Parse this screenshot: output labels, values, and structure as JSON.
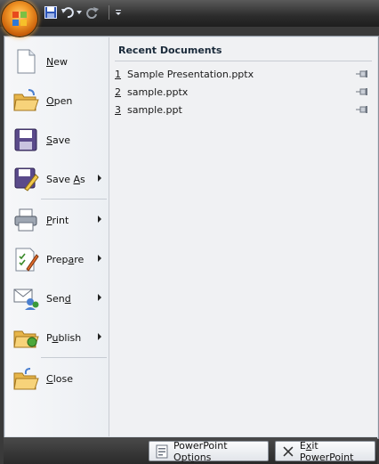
{
  "quick_access": {
    "save_icon": "floppy-icon",
    "undo_icon": "undo-icon",
    "redo_icon": "redo-icon",
    "customize_icon": "dropdown-arrow-icon"
  },
  "menu": {
    "items": [
      {
        "key": "new",
        "prefix": "",
        "u": "N",
        "suffix": "ew",
        "icon": "new-document-icon",
        "has_submenu": false
      },
      {
        "key": "open",
        "prefix": "",
        "u": "O",
        "suffix": "pen",
        "icon": "open-folder-icon",
        "has_submenu": false
      },
      {
        "key": "save",
        "prefix": "",
        "u": "S",
        "suffix": "ave",
        "icon": "floppy-icon",
        "has_submenu": false
      },
      {
        "key": "save-as",
        "prefix": "Save ",
        "u": "A",
        "suffix": "s",
        "icon": "save-as-icon",
        "has_submenu": true
      },
      {
        "key": "print",
        "prefix": "",
        "u": "P",
        "suffix": "rint",
        "icon": "printer-icon",
        "has_submenu": true
      },
      {
        "key": "prepare",
        "prefix": "Prep",
        "u": "a",
        "suffix": "re",
        "icon": "prepare-icon",
        "has_submenu": true
      },
      {
        "key": "send",
        "prefix": "Sen",
        "u": "d",
        "suffix": "",
        "icon": "send-icon",
        "has_submenu": true
      },
      {
        "key": "publish",
        "prefix": "P",
        "u": "u",
        "suffix": "blish",
        "icon": "publish-icon",
        "has_submenu": true
      },
      {
        "key": "close",
        "prefix": "",
        "u": "C",
        "suffix": "lose",
        "icon": "close-folder-icon",
        "has_submenu": false
      }
    ]
  },
  "recent": {
    "title": "Recent Documents",
    "items": [
      {
        "num": "1",
        "name": "Sample Presentation.pptx"
      },
      {
        "num": "2",
        "name": "sample.pptx"
      },
      {
        "num": "3",
        "name": "sample.ppt"
      }
    ]
  },
  "footer": {
    "options_prefix": "PowerPoint Opt",
    "options_u": "i",
    "options_suffix": "ons",
    "exit_prefix": "E",
    "exit_u": "x",
    "exit_suffix": "it PowerPoint"
  }
}
